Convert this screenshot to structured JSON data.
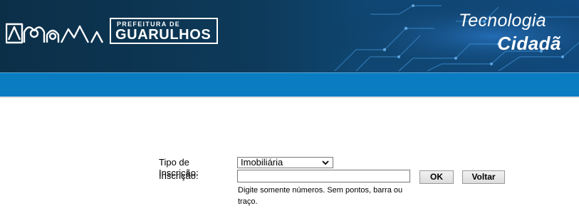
{
  "header": {
    "logo": {
      "line1": "PREFEITURA DE",
      "line2": "GUARULHOS"
    },
    "brand": {
      "line1": "Tecnologia",
      "line2": "Cidadã"
    }
  },
  "form": {
    "tipo_label": "Tipo de Inscrição:",
    "tipo_selected": "Imobiliária",
    "inscricao_label": "Inscrição:",
    "inscricao_value": "",
    "ok_label": "OK",
    "voltar_label": "Voltar",
    "hint": "Digite somente números. Sem pontos, barra ou traço."
  },
  "colors": {
    "banner_dark": "#0c2f48",
    "blue_bar": "#0a7cc2"
  }
}
